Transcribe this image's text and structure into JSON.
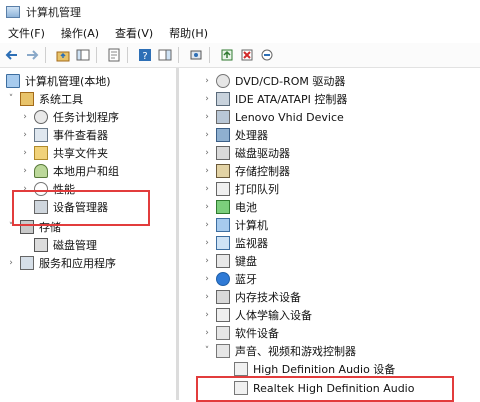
{
  "window": {
    "title": "计算机管理"
  },
  "menu": [
    {
      "name": "file",
      "label": "文件(F)"
    },
    {
      "name": "action",
      "label": "操作(A)"
    },
    {
      "name": "view",
      "label": "查看(V)"
    },
    {
      "name": "help",
      "label": "帮助(H)"
    }
  ],
  "left_tree": {
    "root": "计算机管理(本地)",
    "system_tools": "系统工具",
    "task_scheduler": "任务计划程序",
    "event_viewer": "事件查看器",
    "shared_folders": "共享文件夹",
    "local_users_groups": "本地用户和组",
    "performance": "性能",
    "device_manager": "设备管理器",
    "storage": "存储",
    "disk_management": "磁盘管理",
    "services_apps": "服务和应用程序"
  },
  "right_tree": {
    "dvd": "DVD/CD-ROM 驱动器",
    "ide": "IDE ATA/ATAPI 控制器",
    "lenovo_vhid": "Lenovo Vhid Device",
    "processors": "处理器",
    "disk_drives": "磁盘驱动器",
    "storage_controllers": "存储控制器",
    "print_queues": "打印队列",
    "batteries": "电池",
    "computer": "计算机",
    "monitors": "监视器",
    "keyboards": "键盘",
    "bluetooth": "蓝牙",
    "firmware": "内存技术设备",
    "hid": "人体学输入设备",
    "software_devices": "软件设备",
    "sound": "声音、视频和游戏控制器",
    "hd_audio_device": "High Definition Audio 设备",
    "realtek": "Realtek High Definition Audio"
  },
  "colors": {
    "highlight": "#e23c3c"
  }
}
